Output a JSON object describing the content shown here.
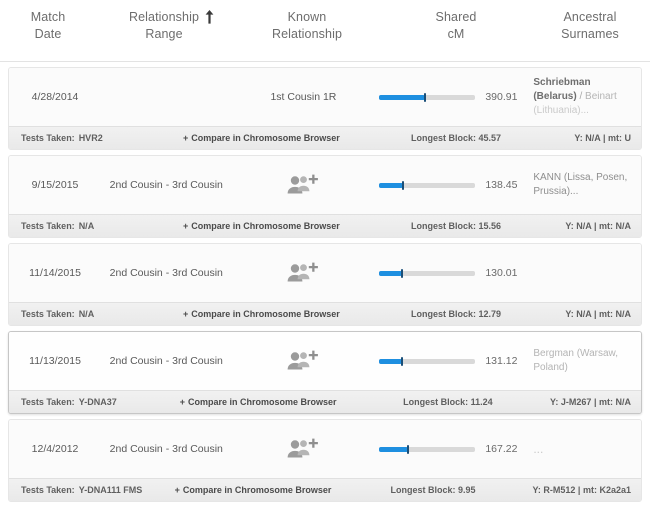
{
  "header": {
    "columns": [
      {
        "name": "match-date",
        "line1": "Match",
        "line2": "Date"
      },
      {
        "name": "relationship-range",
        "line1": "Relationship",
        "line2": "Range",
        "sort": "ascending",
        "sort_icon": "arrow-up-icon"
      },
      {
        "name": "known-relationship",
        "line1": "Known",
        "line2": "Relationship"
      },
      {
        "name": "shared-cm",
        "line1": "Shared",
        "line2": "cM"
      },
      {
        "name": "ancestral-surnames",
        "line1": "Ancestral",
        "line2": "Surnames"
      }
    ]
  },
  "colors": {
    "bar_fill": "#1e8fe0",
    "bar_track": "#d9d9d9",
    "bar_tick": "#1b4f78",
    "card_bg": "#fbfbfb",
    "footer_bg": "#eeeeee",
    "page_bg": "#ffffff"
  },
  "footer_labels": {
    "tests_taken": "Tests Taken:",
    "compare_link": "Compare in Chromosome Browser",
    "compare_plus": "+",
    "longest_block": "Longest Block:",
    "y_label": "Y:",
    "mt_label": "mt:",
    "separator": "|"
  },
  "rows": [
    {
      "selected": false,
      "match_date": "4/28/2014",
      "relationship_range": "",
      "known_relationship": "1st Cousin 1R",
      "has_tree_icon": false,
      "tree_icon": "add-to-tree-icon",
      "shared_cm": "390.91",
      "bar_fill_pct": 48,
      "bar_tick_pct": 48,
      "surnames_html": "<span class=\"sn-strong\">Schriebman</span><br><span class=\"sn-strong\">(Belarus)</span> <span class=\"sn-sep\">/</span> <span class=\"sn-fade\">Beinart</span><br><span class=\"sn-faint\">(Lithuania)...</span>",
      "surnames_text": "Schriebman (Belarus) / Beinart (Lithuania)...",
      "tests_taken": "HVR2",
      "longest_block": "45.57",
      "y_haplogroup": "N/A",
      "mt_haplogroup": "U"
    },
    {
      "selected": false,
      "match_date": "9/15/2015",
      "relationship_range": "2nd Cousin - 3rd Cousin",
      "known_relationship": "",
      "has_tree_icon": true,
      "tree_icon": "add-to-tree-icon",
      "shared_cm": "138.45",
      "bar_fill_pct": 25,
      "bar_tick_pct": 25,
      "surnames_html": "KANN (Lissa, Posen,<br>Prussia)...",
      "surnames_text": "KANN (Lissa, Posen, Prussia)...",
      "tests_taken": "N/A",
      "longest_block": "15.56",
      "y_haplogroup": "N/A",
      "mt_haplogroup": "N/A"
    },
    {
      "selected": false,
      "match_date": "11/14/2015",
      "relationship_range": "2nd Cousin - 3rd Cousin",
      "known_relationship": "",
      "has_tree_icon": true,
      "tree_icon": "add-to-tree-icon",
      "shared_cm": "130.01",
      "bar_fill_pct": 24,
      "bar_tick_pct": 24,
      "surnames_html": "",
      "surnames_text": "",
      "tests_taken": "N/A",
      "longest_block": "12.79",
      "y_haplogroup": "N/A",
      "mt_haplogroup": "N/A"
    },
    {
      "selected": true,
      "match_date": "11/13/2015",
      "relationship_range": "2nd Cousin - 3rd Cousin",
      "known_relationship": "",
      "has_tree_icon": true,
      "tree_icon": "add-to-tree-icon",
      "shared_cm": "131.12",
      "bar_fill_pct": 24,
      "bar_tick_pct": 24,
      "surnames_html": "<span class=\"sn-fade\">Bergman (Warsaw,<br>Poland)</span>",
      "surnames_text": "Bergman (Warsaw, Poland)",
      "tests_taken": "Y-DNA37",
      "longest_block": "11.24",
      "y_haplogroup": "J-M267",
      "mt_haplogroup": "N/A"
    },
    {
      "selected": false,
      "match_date": "12/4/2012",
      "relationship_range": "2nd Cousin - 3rd Cousin",
      "known_relationship": "",
      "has_tree_icon": true,
      "tree_icon": "add-to-tree-icon",
      "shared_cm": "167.22",
      "bar_fill_pct": 30,
      "bar_tick_pct": 30,
      "surnames_html": "<span class=\"sn-faint\">...</span>",
      "surnames_text": "...",
      "tests_taken": "Y-DNA111  FMS",
      "longest_block": "9.95",
      "y_haplogroup": "R-M512",
      "mt_haplogroup": "K2a2a1"
    }
  ]
}
